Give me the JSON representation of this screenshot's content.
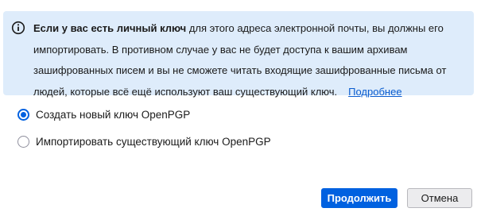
{
  "notice": {
    "icon": "info-icon",
    "bold_text": "Если у вас есть личный ключ",
    "body_text": " для этого адреса электронной почты, вы должны его импортировать. В противном случае у вас не будет доступа к вашим архивам зашифрованных писем и вы не сможете читать входящие зашифрованные письма от людей, которые всё ещё используют ваш существующий ключ.",
    "link_text": "Подробнее"
  },
  "options": {
    "create_label": "Создать новый ключ OpenPGP",
    "create_selected": true,
    "import_label": "Импортировать существующий ключ OpenPGP",
    "import_selected": false
  },
  "buttons": {
    "continue_label": "Продолжить",
    "cancel_label": "Отмена"
  },
  "colors": {
    "accent": "#0061e0",
    "notice_background": "#deecfb",
    "link": "#0a5ccf"
  }
}
